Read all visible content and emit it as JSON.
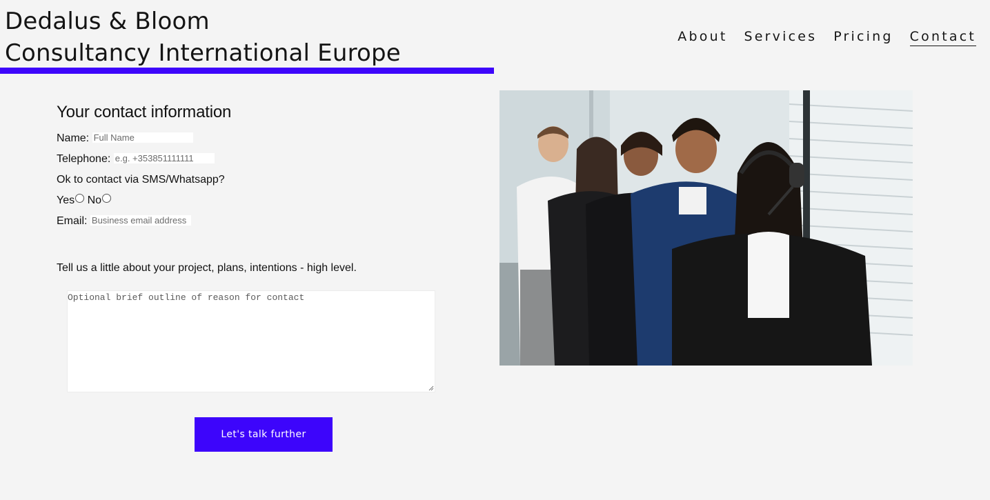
{
  "header": {
    "brand_line1": "Dedalus & Bloom",
    "brand_line2": "Consultancy International Europe",
    "accent_color": "#3d05fb"
  },
  "nav": {
    "items": [
      {
        "label": "About",
        "active": false
      },
      {
        "label": "Services",
        "active": false
      },
      {
        "label": "Pricing",
        "active": false
      },
      {
        "label": "Contact",
        "active": true
      }
    ]
  },
  "form": {
    "title": "Your contact information",
    "name_label": "Name:",
    "name_placeholder": "Full Name",
    "telephone_label": "Telephone:",
    "telephone_placeholder": "e.g. +353851111111",
    "sms_question": "Ok to contact via SMS/Whatsapp?",
    "yes_label": "Yes",
    "no_label": "No",
    "email_label": "Email:",
    "email_placeholder": "Business email address",
    "intro": "Tell us a little about your project, plans, intentions - high level.",
    "message_placeholder": "Optional brief outline of reason for contact",
    "submit_label": "Let's talk further"
  },
  "image": {
    "icon": "team-photo-icon"
  }
}
